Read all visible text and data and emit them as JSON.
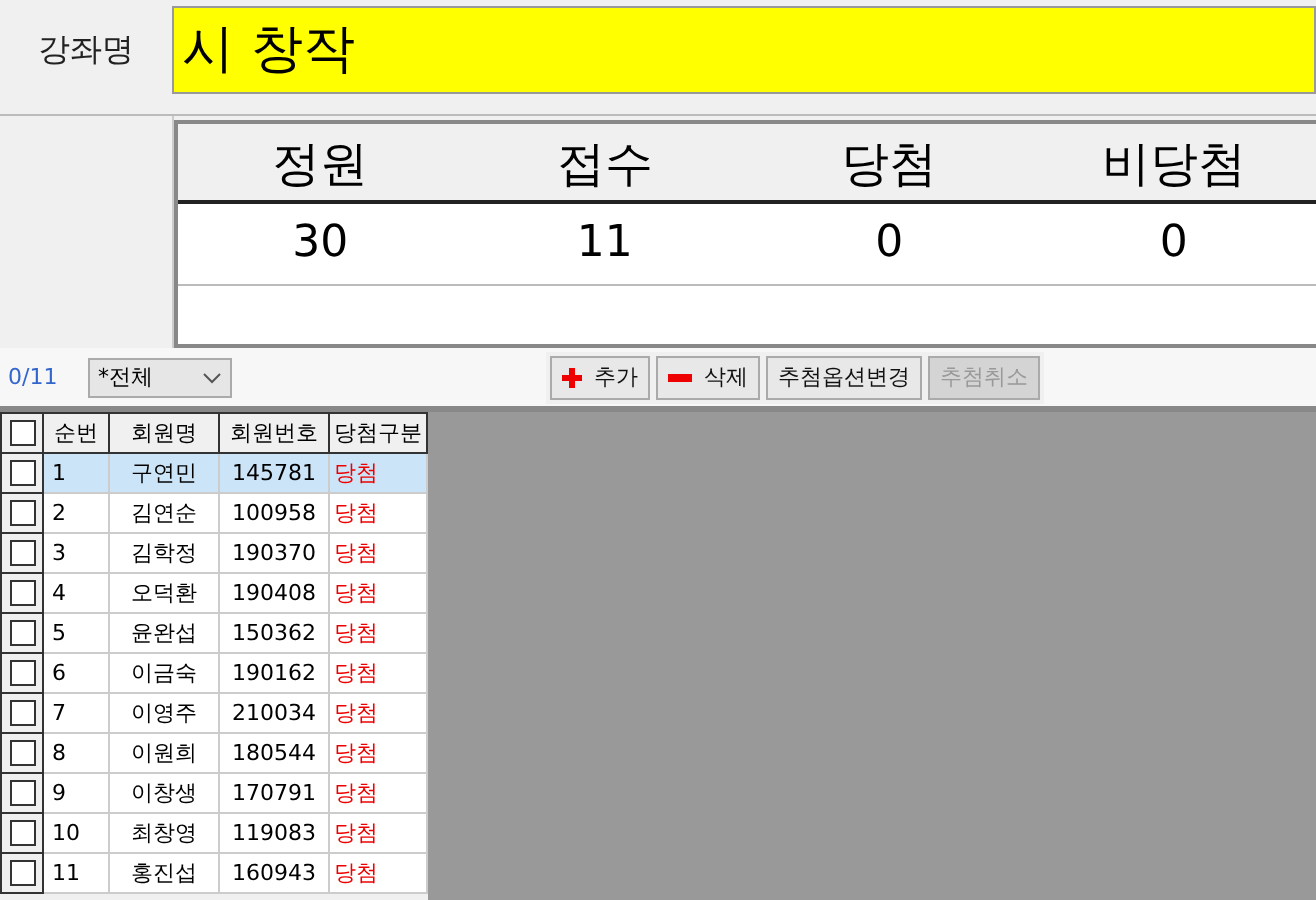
{
  "course": {
    "label": "강좌명",
    "value": "시 창작"
  },
  "stats": {
    "columns": [
      "정원",
      "접수",
      "당첨",
      "비당첨"
    ],
    "values": [
      "30",
      "11",
      "0",
      "0"
    ]
  },
  "toolbar": {
    "counter": "0/11",
    "filter": "*전체",
    "buttons": [
      {
        "label": "추가",
        "kind": "add",
        "disabled": false
      },
      {
        "label": "삭제",
        "kind": "delete",
        "disabled": false
      },
      {
        "label": "추첨옵션변경",
        "kind": "plain",
        "disabled": false
      },
      {
        "label": "추첨취소",
        "kind": "plain",
        "disabled": true
      }
    ]
  },
  "table": {
    "header_checked": false,
    "columns": [
      "순번",
      "회원명",
      "회원번호",
      "당첨구분"
    ],
    "rows": [
      {
        "no": "1",
        "name": "구연민",
        "member_no": "145781",
        "result": "당첨",
        "checked": false,
        "selected": true
      },
      {
        "no": "2",
        "name": "김연순",
        "member_no": "100958",
        "result": "당첨",
        "checked": false,
        "selected": false
      },
      {
        "no": "3",
        "name": "김학정",
        "member_no": "190370",
        "result": "당첨",
        "checked": false,
        "selected": false
      },
      {
        "no": "4",
        "name": "오덕환",
        "member_no": "190408",
        "result": "당첨",
        "checked": false,
        "selected": false
      },
      {
        "no": "5",
        "name": "윤완섭",
        "member_no": "150362",
        "result": "당첨",
        "checked": false,
        "selected": false
      },
      {
        "no": "6",
        "name": "이금숙",
        "member_no": "190162",
        "result": "당첨",
        "checked": false,
        "selected": false
      },
      {
        "no": "7",
        "name": "이영주",
        "member_no": "210034",
        "result": "당첨",
        "checked": false,
        "selected": false
      },
      {
        "no": "8",
        "name": "이원희",
        "member_no": "180544",
        "result": "당첨",
        "checked": false,
        "selected": false
      },
      {
        "no": "9",
        "name": "이창생",
        "member_no": "170791",
        "result": "당첨",
        "checked": false,
        "selected": false
      },
      {
        "no": "10",
        "name": "최창영",
        "member_no": "119083",
        "result": "당첨",
        "checked": false,
        "selected": false
      },
      {
        "no": "11",
        "name": "홍진섭",
        "member_no": "160943",
        "result": "당첨",
        "checked": false,
        "selected": false
      }
    ]
  }
}
